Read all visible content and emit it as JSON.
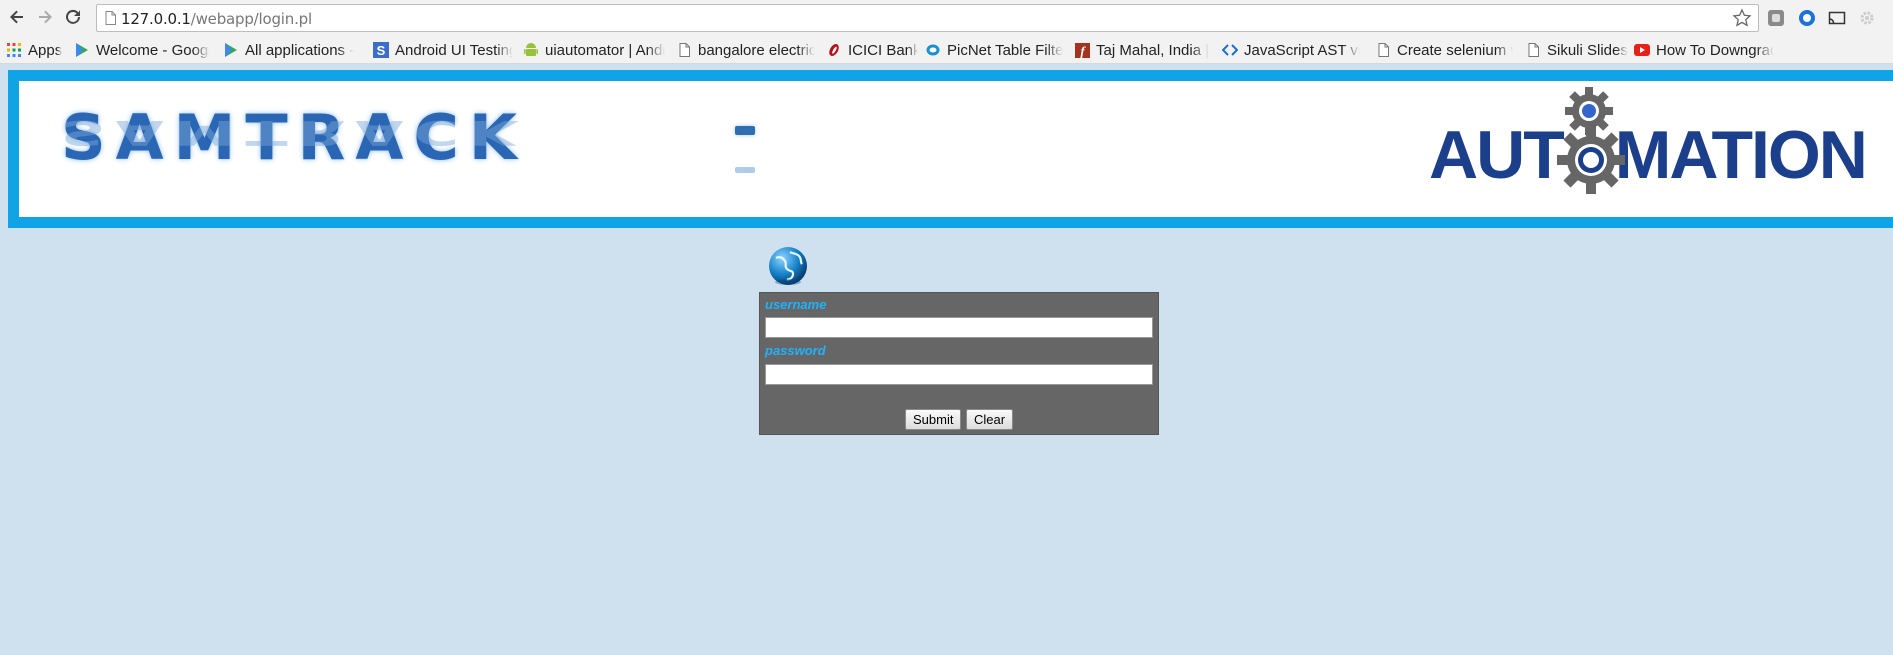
{
  "toolbar": {
    "url_host": "127.0.0.1",
    "url_path": "/webapp/login.pl"
  },
  "bookmarks": [
    {
      "label": "Apps",
      "icon": "apps-grid-icon"
    },
    {
      "label": "Welcome - Google",
      "icon": "play-store-icon"
    },
    {
      "label": "All applications -",
      "icon": "play-store-icon"
    },
    {
      "label": "Android UI Testing",
      "icon": "s-logo-icon"
    },
    {
      "label": "uiautomator | Android",
      "icon": "android-icon"
    },
    {
      "label": "bangalore electricity",
      "icon": "page-icon"
    },
    {
      "label": "ICICI Bank",
      "icon": "icici-icon"
    },
    {
      "label": "PicNet Table Filter",
      "icon": "picnet-icon"
    },
    {
      "label": "Taj Mahal, India |",
      "icon": "f-logo-icon"
    },
    {
      "label": "JavaScript AST vis",
      "icon": "code-arrows-icon"
    },
    {
      "label": "Create selenium v",
      "icon": "page-icon"
    },
    {
      "label": "Sikuli Slides",
      "icon": "page-icon"
    },
    {
      "label": "How To Downgrade",
      "icon": "youtube-icon"
    }
  ],
  "banner": {
    "brand": "SAMTRACK",
    "automation_pre": "AUT",
    "automation_post": "MATION"
  },
  "login": {
    "username_label": "username",
    "password_label": "password",
    "username_value": "",
    "password_value": "",
    "submit_label": "Submit",
    "clear_label": "Clear"
  },
  "colors": {
    "page_bg": "#cfe0ef",
    "banner_border": "#10a4e6",
    "panel_bg": "#666666",
    "label": "#1fb2ff",
    "brand": "#2b66b4",
    "automation": "#1c3f8c"
  }
}
